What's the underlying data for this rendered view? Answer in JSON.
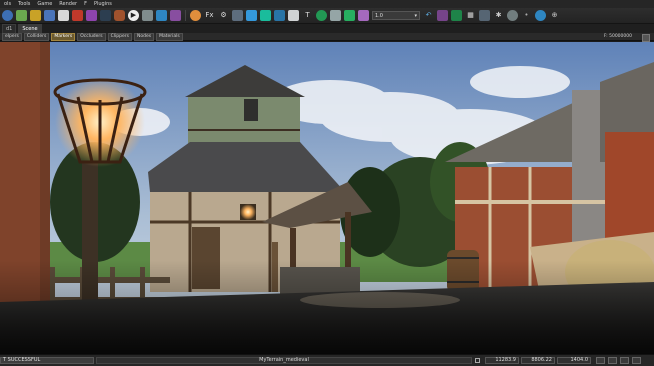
{
  "menu": {
    "items": [
      "ols",
      "Tools",
      "Game",
      "Render",
      "F",
      "Plugins"
    ]
  },
  "toolbar": {
    "layer_dropdown_value": "1.0"
  },
  "document_tabs": [
    {
      "label": "d1",
      "active": false
    },
    {
      "label": "Scene",
      "active": true
    }
  ],
  "filters": {
    "buttons": [
      {
        "label": "elpers",
        "active": false
      },
      {
        "label": "Colliders",
        "active": false
      },
      {
        "label": "Markers",
        "active": true
      },
      {
        "label": "Occluders",
        "active": false
      },
      {
        "label": "Clippers",
        "active": false
      },
      {
        "label": "Nodes",
        "active": false
      },
      {
        "label": "Materials",
        "active": false
      }
    ],
    "zoom_value": "F: 50000000"
  },
  "status": {
    "message": "T SUCCESSFUL",
    "level_name": "MyTerrain_medieval",
    "coord_x": "11283.9",
    "coord_y": "8806.22",
    "coord_z": "1404.0"
  },
  "colors": {
    "sky_top": "#5f82b8",
    "sky_horizon": "#d9e2ea",
    "active_filter": "#a5873e",
    "fire": "#ffb560"
  }
}
